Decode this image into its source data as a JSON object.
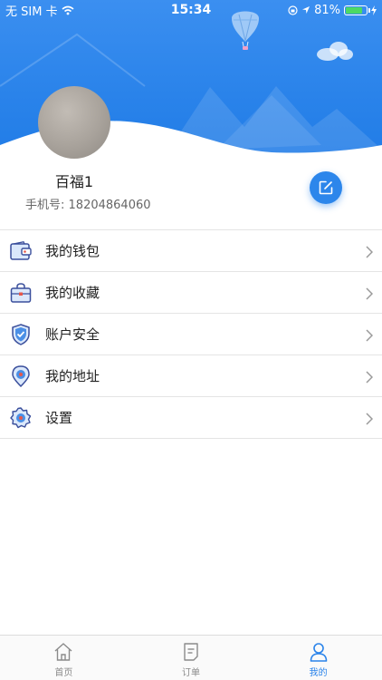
{
  "status_bar": {
    "carrier": "无 SIM 卡",
    "time": "15:34",
    "battery": "81%",
    "battery_level": 0.81
  },
  "profile": {
    "name": "百福1",
    "phone_label": "手机号:",
    "phone": "18204864060"
  },
  "menu": [
    {
      "label": "我的钱包",
      "icon": "wallet-icon"
    },
    {
      "label": "我的收藏",
      "icon": "favorites-bag-icon"
    },
    {
      "label": "账户安全",
      "icon": "shield-check-icon"
    },
    {
      "label": "我的地址",
      "icon": "location-pin-icon"
    },
    {
      "label": "设置",
      "icon": "gear-icon"
    }
  ],
  "tabbar": {
    "tabs": [
      {
        "label": "首页",
        "icon": "home-icon",
        "active": false
      },
      {
        "label": "订单",
        "icon": "order-icon",
        "active": false
      },
      {
        "label": "我的",
        "icon": "user-icon",
        "active": true
      }
    ]
  },
  "colors": {
    "accent": "#2a83ea",
    "header_top": "#3b8ff0",
    "battery_fill": "#4cd964"
  }
}
